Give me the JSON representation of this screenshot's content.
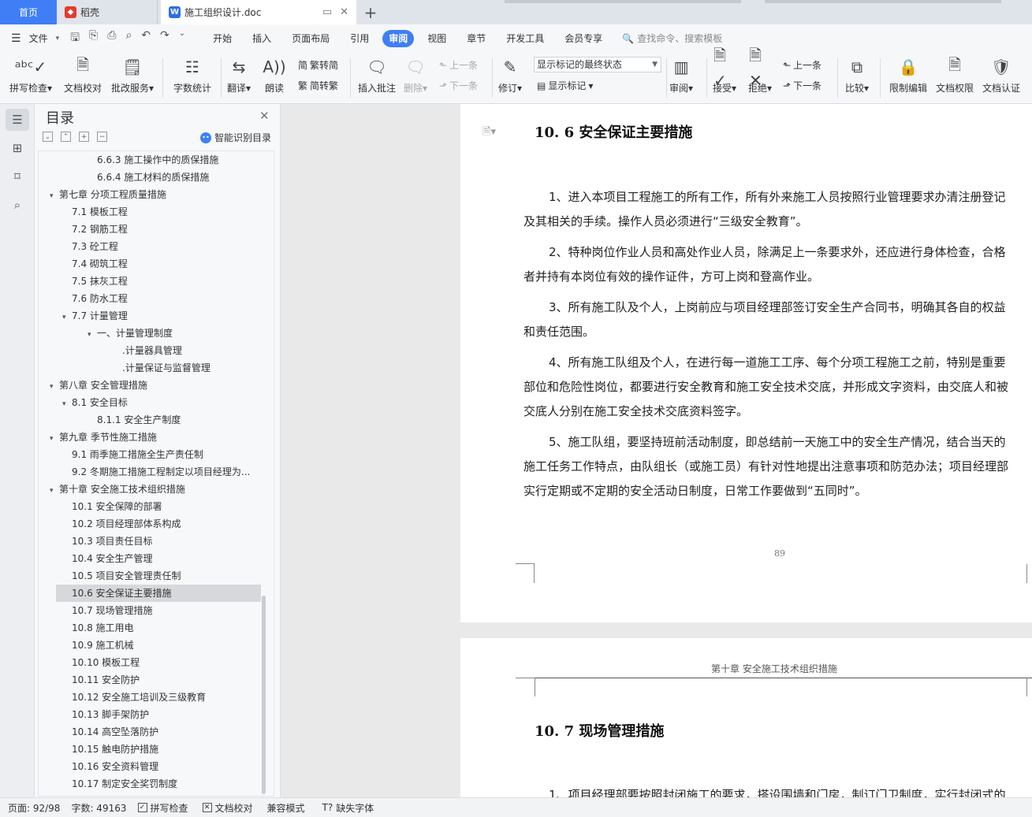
{
  "tabs": {
    "home": "首页",
    "daoke": "稻壳",
    "doc": "施工组织设计.doc",
    "add": "+"
  },
  "menubar": {
    "file": "文件",
    "items": [
      "开始",
      "插入",
      "页面布局",
      "引用",
      "审阅",
      "视图",
      "章节",
      "开发工具",
      "会员专享"
    ],
    "active_index": 4,
    "search": "查找命令、搜索模板"
  },
  "ribbon": {
    "spell": "拼写检查",
    "proof": "文档校对",
    "batch": "批改服务",
    "wordcount": "字数统计",
    "translate": "翻译",
    "read": "朗读",
    "to_trad": "繁转简",
    "to_simp": "简转繁",
    "insert_comment": "插入批注",
    "delete": "删除",
    "prev": "上一条",
    "next": "下一条",
    "revise": "修订",
    "markup_state": "显示标记的最终状态",
    "show_markup": "显示标记",
    "review": "审阅",
    "accept": "接受",
    "reject": "拒绝",
    "prev2": "上一条",
    "next2": "下一条",
    "compare": "比较",
    "restrict": "限制编辑",
    "permission": "文档权限",
    "certify": "文档认证"
  },
  "toc": {
    "title": "目录",
    "smart": "智能识别目录",
    "items": [
      {
        "text": "6.6.3 施工操作中的质保措施",
        "level": 3,
        "caret": ""
      },
      {
        "text": "6.6.4 施工材料的质保措施",
        "level": 3,
        "caret": ""
      },
      {
        "text": "第七章  分项工程质量措施",
        "level": 1,
        "caret": "v"
      },
      {
        "text": "7.1 模板工程",
        "level": 2,
        "caret": ""
      },
      {
        "text": "7.2 钢筋工程",
        "level": 2,
        "caret": ""
      },
      {
        "text": "7.3 砼工程",
        "level": 2,
        "caret": ""
      },
      {
        "text": "7.4 砌筑工程",
        "level": 2,
        "caret": ""
      },
      {
        "text": "7.5 抹灰工程",
        "level": 2,
        "caret": ""
      },
      {
        "text": "7.6 防水工程",
        "level": 2,
        "caret": ""
      },
      {
        "text": "7.7  计量管理",
        "level": 2,
        "caret": "v"
      },
      {
        "text": "一、计量管理制度",
        "level": 3,
        "caret": "v"
      },
      {
        "text": ".计量器具管理",
        "level": 4,
        "caret": ""
      },
      {
        "text": ".计量保证与监督管理",
        "level": 4,
        "caret": ""
      },
      {
        "text": "第八章  安全管理措施",
        "level": 1,
        "caret": "v"
      },
      {
        "text": "8.1  安全目标",
        "level": 2,
        "caret": "v"
      },
      {
        "text": "8.1.1 安全生产制度",
        "level": 3,
        "caret": ""
      },
      {
        "text": "第九章  季节性施工措施",
        "level": 1,
        "caret": "v"
      },
      {
        "text": "9.1  雨季施工措施全生产责任制",
        "level": 2,
        "caret": ""
      },
      {
        "text": "9.2  冬期施工措施工程制定以项目经理为...",
        "level": 2,
        "caret": ""
      },
      {
        "text": "第十章  安全施工技术组织措施",
        "level": 1,
        "caret": "v"
      },
      {
        "text": "10.1 安全保障的部署",
        "level": 2,
        "caret": ""
      },
      {
        "text": "10.2 项目经理部体系构成",
        "level": 2,
        "caret": ""
      },
      {
        "text": "10.3 项目责任目标",
        "level": 2,
        "caret": ""
      },
      {
        "text": "10.4 安全生产管理",
        "level": 2,
        "caret": ""
      },
      {
        "text": "10.5 项目安全管理责任制",
        "level": 2,
        "caret": ""
      },
      {
        "text": "10.6 安全保证主要措施",
        "level": 2,
        "caret": "",
        "selected": true
      },
      {
        "text": "10.7 现场管理措施",
        "level": 2,
        "caret": ""
      },
      {
        "text": "10.8 施工用电",
        "level": 2,
        "caret": ""
      },
      {
        "text": "10.9 施工机械",
        "level": 2,
        "caret": ""
      },
      {
        "text": "10.10 模板工程",
        "level": 2,
        "caret": ""
      },
      {
        "text": "10.11 安全防护",
        "level": 2,
        "caret": ""
      },
      {
        "text": "10.12 安全施工培训及三级教育",
        "level": 2,
        "caret": ""
      },
      {
        "text": "10.13 脚手架防护",
        "level": 2,
        "caret": ""
      },
      {
        "text": "10.14 高空坠落防护",
        "level": 2,
        "caret": ""
      },
      {
        "text": "10.15 触电防护措施",
        "level": 2,
        "caret": ""
      },
      {
        "text": "10.16 安全资料管理",
        "level": 2,
        "caret": ""
      },
      {
        "text": "10.17 制定安全奖罚制度",
        "level": 2,
        "caret": ""
      }
    ]
  },
  "doc": {
    "heading1": "10. 6 安全保证主要措施",
    "paragraphs": [
      [
        "1、进入本项目工程施工的所有工作，所有外来施工人员按照行业管理要求办清注册登记",
        "及其相关的手续。操作人员必须进行“三级安全教育”。"
      ],
      [
        "2、特种岗位作业人员和高处作业人员，除满足上一条要求外，还应进行身体检查，合格",
        "者并持有本岗位有效的操作证件，方可上岗和登高作业。"
      ],
      [
        "3、所有施工队及个人，上岗前应与项目经理部签订安全生产合同书，明确其各自的权益",
        "和责任范围。"
      ],
      [
        "4、所有施工队组及个人，在进行每一道施工工序、每个分项工程施工之前，特别是重要",
        "部位和危险性岗位，都要进行安全教育和施工安全技术交底，并形成文字资料，由交底人和被",
        "交底人分别在施工安全技术交底资料签字。"
      ],
      [
        "5、施工队组，要坚持班前活动制度，即总结前一天施工中的安全生产情况，结合当天的",
        "施工任务工作特点，由队组长（或施工员）有针对性地提出注意事项和防范办法；项目经理部",
        "实行定期或不定期的安全活动日制度，日常工作要做到“五同时”。"
      ]
    ],
    "page_number": "89",
    "running_header": "第十章    安全施工技术组织措施",
    "heading2": "10. 7 现场管理措施",
    "page2_line": "1、项目经理部要按照封闭施工的要求，搭设围墙和门房，制订门卫制度，实行封闭式的"
  },
  "status": {
    "page": "页面: 92/98",
    "words": "字数: 49163",
    "spell": "拼写检查",
    "proof": "文档校对",
    "compat": "兼容模式",
    "missing_font": "缺失字体"
  }
}
